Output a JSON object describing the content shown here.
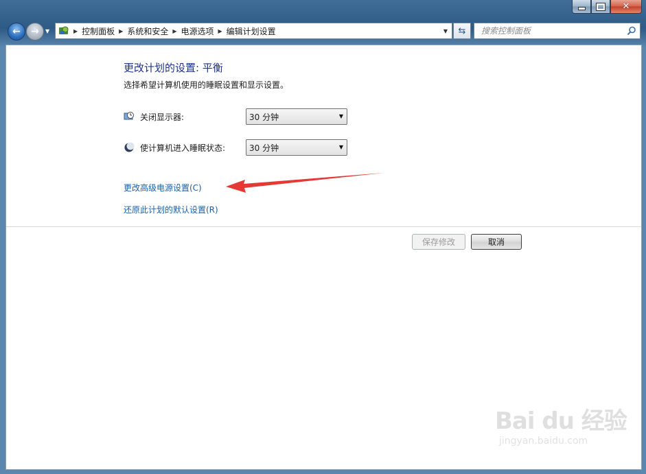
{
  "window": {
    "minimize_icon": "minimize-icon",
    "maximize_icon": "maximize-icon",
    "close_icon": "close-icon"
  },
  "navigation": {
    "back_icon": "back-arrow-icon",
    "forward_icon": "forward-arrow-icon",
    "breadcrumbs": [
      "控制面板",
      "系统和安全",
      "电源选项",
      "编辑计划设置"
    ],
    "search_placeholder": "搜索控制面板",
    "refresh_icon": "refresh-icon"
  },
  "page": {
    "title": "更改计划的设置: 平衡",
    "subtitle": "选择希望计算机使用的睡眠设置和显示设置。",
    "settings": [
      {
        "label": "关闭显示器:",
        "value": "30 分钟",
        "icon": "monitor-clock-icon"
      },
      {
        "label": "使计算机进入睡眠状态:",
        "value": "30 分钟",
        "icon": "moon-sleep-icon"
      }
    ],
    "links": {
      "advanced": "更改高级电源设置(C)",
      "restore": "还原此计划的默认设置(R)"
    },
    "buttons": {
      "save": "保存修改",
      "cancel": "取消"
    },
    "annotation_color": "#e53935"
  },
  "watermark": {
    "main": "Bai du 经验",
    "sub": "jingyan.baidu.com"
  }
}
